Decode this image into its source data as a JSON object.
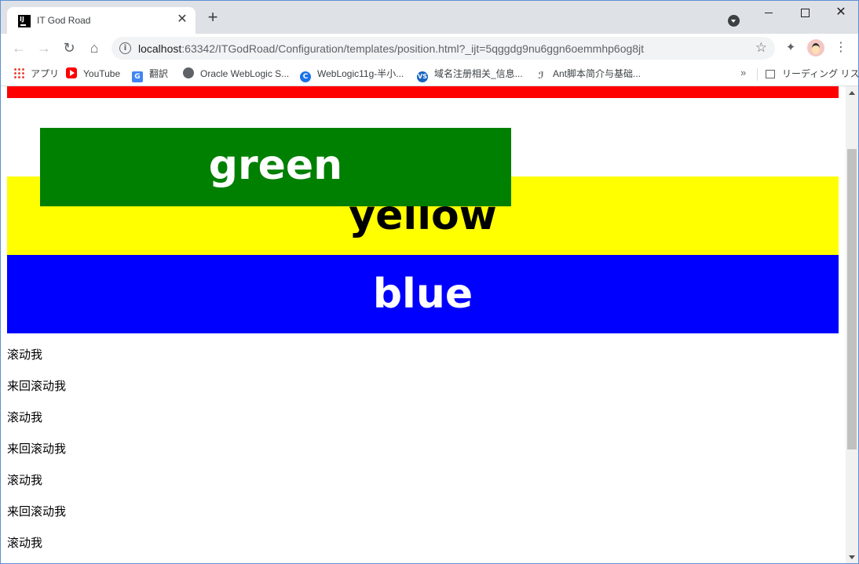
{
  "browser": {
    "tab_title": "IT God Road",
    "tab_close": "✕",
    "new_tab": "+",
    "address": {
      "host": "localhost",
      "path": ":63342/ITGodRoad/Configuration/templates/position.html?_ijt=5qggdg9nu6ggn6oemmhp6og8jt"
    },
    "window_close": "✕",
    "back": "←",
    "forward": "→",
    "reload": "↻",
    "home": "⌂",
    "info": "i",
    "star": "☆",
    "menu": "⋮",
    "extensions": "✦"
  },
  "bookmarks": {
    "items": [
      {
        "label": "アプリ",
        "icon": "apps-icon"
      },
      {
        "label": "YouTube",
        "icon": "youtube-icon"
      },
      {
        "label": "翻訳",
        "icon": "google-translate-icon"
      },
      {
        "label": "Oracle WebLogic S...",
        "icon": "globe-icon"
      },
      {
        "label": "WebLogic11g-半小...",
        "icon": "c-logo-icon"
      },
      {
        "label": "域名注册相关_信息...",
        "icon": "vs-logo-icon"
      },
      {
        "label": "Ant脚本简介与基础...",
        "icon": "ant-icon"
      }
    ],
    "more": "»",
    "reading_list": "リーディング リスト"
  },
  "page": {
    "yellow_label": "yellow",
    "blue_label": "blue",
    "green_label": "green",
    "lines": [
      "滚动我",
      "来回滚动我",
      "滚动我",
      "来回滚动我",
      "滚动我",
      "来回滚动我",
      "滚动我"
    ]
  },
  "colors": {
    "red": "#ff0000",
    "yellow": "#ffff00",
    "blue": "#0000ff",
    "green": "#008000"
  }
}
